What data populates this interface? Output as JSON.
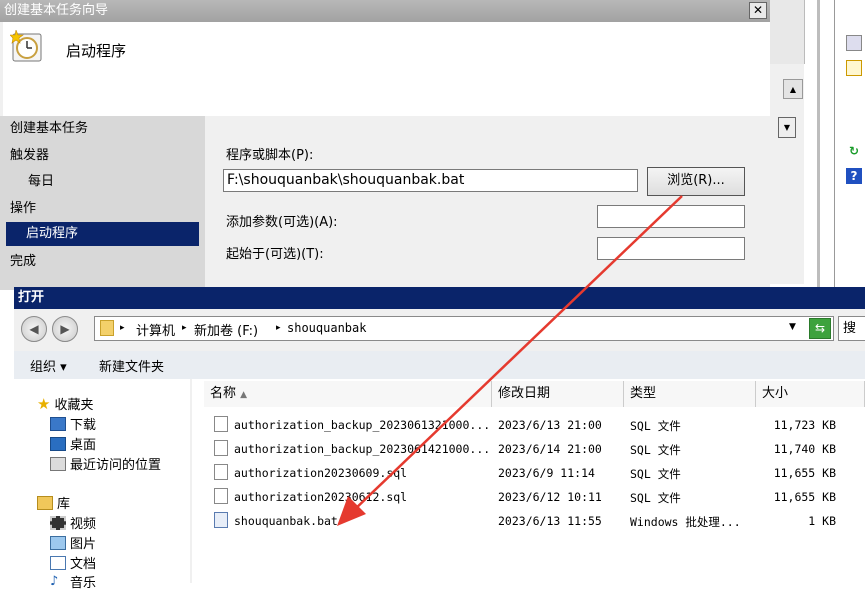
{
  "wizard": {
    "title": "创建基本任务向导",
    "close_glyph": "✕",
    "header_title": "启动程序",
    "nav": [
      "创建基本任务",
      "触发器",
      "每日",
      "操作",
      "启动程序",
      "完成"
    ],
    "program_label": "程序或脚本(P):",
    "program_value": "F:\\shouquanbak\\shouquanbak.bat",
    "browse_label": "浏览(R)...",
    "args_label": "添加参数(可选)(A):",
    "args_value": "",
    "start_in_label": "起始于(可选)(T):",
    "start_in_value": ""
  },
  "open_dialog": {
    "title": "打开",
    "breadcrumb": [
      "计算机",
      "新加卷 (F:)",
      "shouquanbak"
    ],
    "search_label": "搜",
    "toolbar": {
      "organize": "组织 ▾",
      "new_folder": "新建文件夹"
    },
    "tree": {
      "favorites": "收藏夹",
      "downloads": "下载",
      "desktop": "桌面",
      "recent": "最近访问的位置",
      "libraries": "库",
      "videos": "视频",
      "pictures": "图片",
      "documents": "文档",
      "music": "音乐"
    },
    "columns": [
      "名称",
      "修改日期",
      "类型",
      "大小"
    ],
    "files": [
      {
        "name": "authorization_backup_2023061321000...",
        "date": "2023/6/13 21:00",
        "type": "SQL 文件",
        "size": "11,723 KB",
        "icon": "sql-file-icon"
      },
      {
        "name": "authorization_backup_2023061421000...",
        "date": "2023/6/14 21:00",
        "type": "SQL 文件",
        "size": "11,740 KB",
        "icon": "sql-file-icon"
      },
      {
        "name": "authorization20230609.sql",
        "date": "2023/6/9 11:14",
        "type": "SQL 文件",
        "size": "11,655 KB",
        "icon": "sql-file-icon"
      },
      {
        "name": "authorization20230612.sql",
        "date": "2023/6/12 10:11",
        "type": "SQL 文件",
        "size": "11,655 KB",
        "icon": "sql-file-icon"
      },
      {
        "name": "shouquanbak.bat",
        "date": "2023/6/13 11:55",
        "type": "Windows 批处理...",
        "size": "1 KB",
        "icon": "batch-file-icon"
      }
    ]
  },
  "colors": {
    "accent": "#0a246a",
    "arrow": "#e53a2f"
  }
}
